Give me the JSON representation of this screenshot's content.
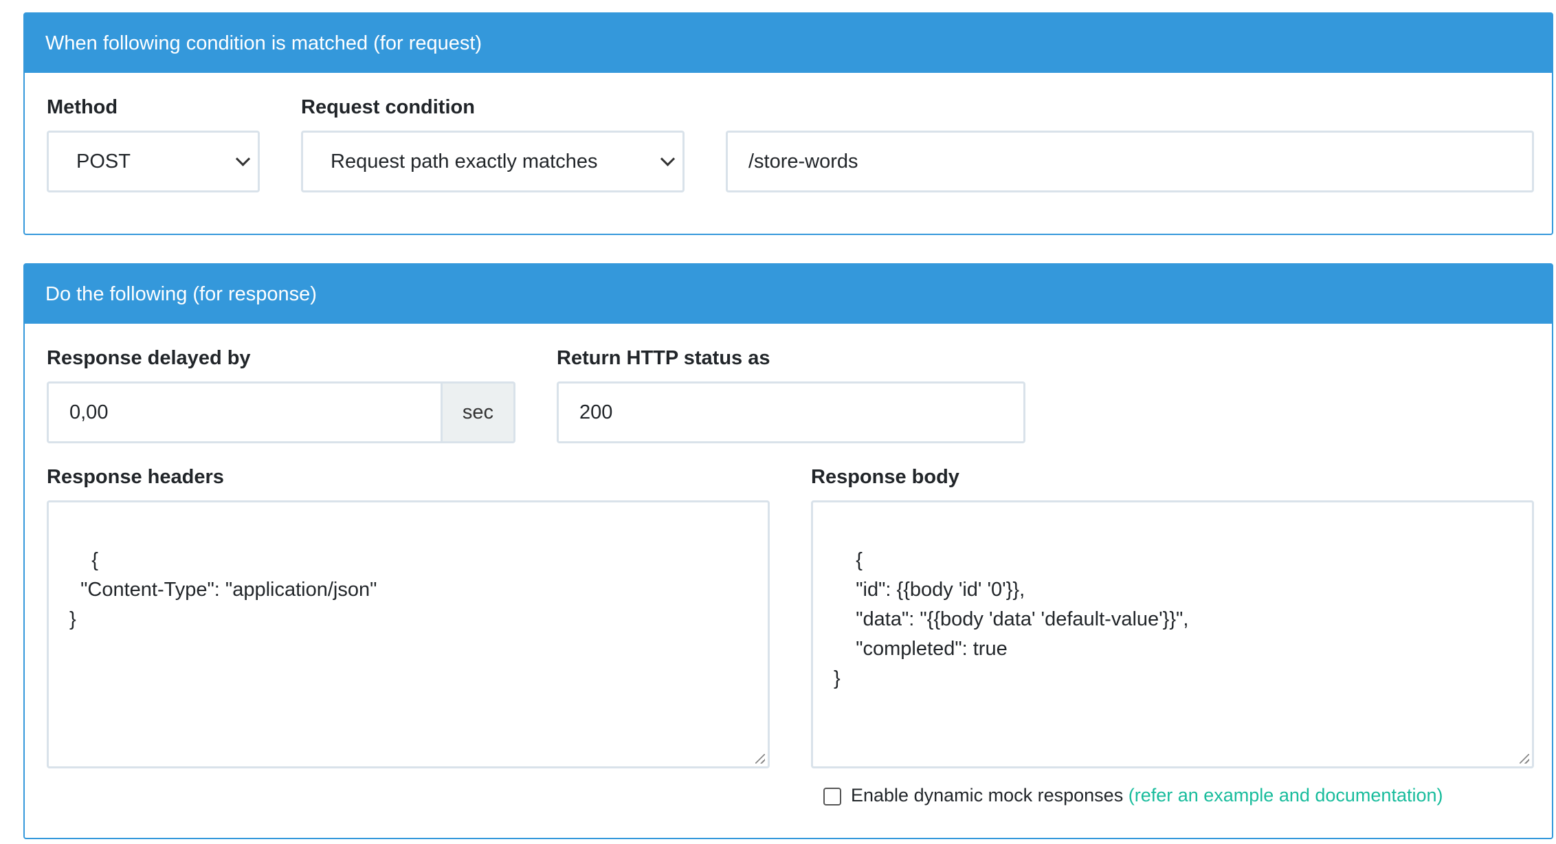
{
  "request_panel": {
    "header": "When following condition is matched (for request)",
    "method_label": "Method",
    "method_value": "POST",
    "condition_label": "Request condition",
    "condition_value": "Request path exactly matches",
    "path_value": "/store-words"
  },
  "response_panel": {
    "header": "Do the following (for response)",
    "delay_label": "Response delayed by",
    "delay_value": "0,00",
    "delay_unit": "sec",
    "status_label": "Return HTTP status as",
    "status_value": "200",
    "headers_label": "Response headers",
    "headers_value": "{\n  \"Content-Type\": \"application/json\"\n}",
    "body_label": "Response body",
    "body_value": "{\n    \"id\": {{body 'id' '0'}},\n    \"data\": \"{{body 'data' 'default-value'}}\",\n    \"completed\": true\n}",
    "dynamic_label": "Enable dynamic mock responses",
    "dynamic_link": "(refer an example and documentation)",
    "dynamic_checked": false
  },
  "colors": {
    "header_bg": "#3498db",
    "link": "#18bc9c",
    "field_border": "#d9e2ea",
    "addon_bg": "#ecf0f1"
  }
}
